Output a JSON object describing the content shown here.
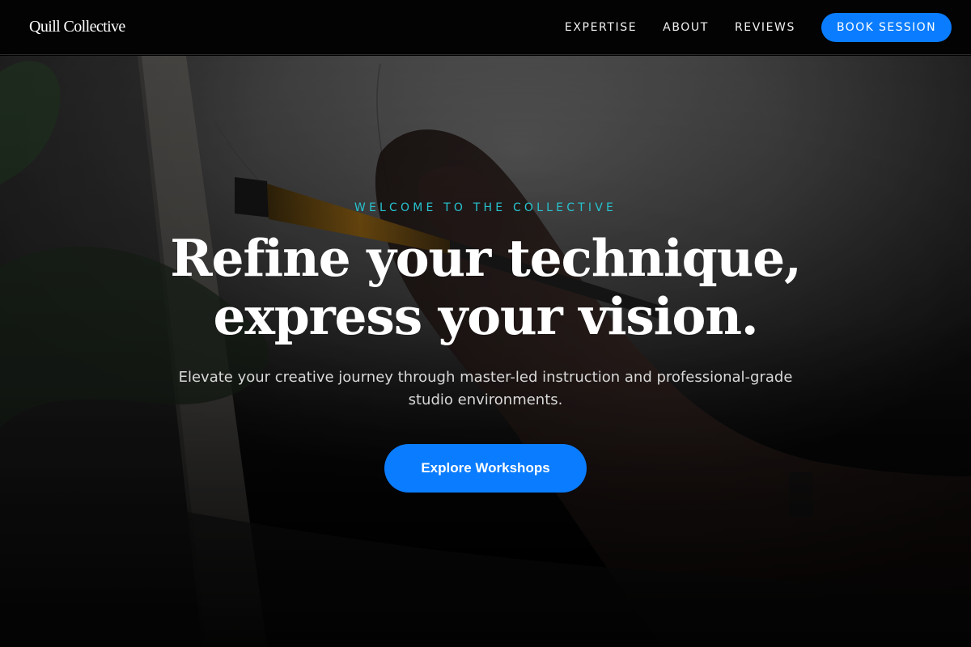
{
  "nav": {
    "brand": "Quill Collective",
    "links": [
      "EXPERTISE",
      "ABOUT",
      "REVIEWS"
    ],
    "cta": "BOOK SESSION"
  },
  "hero": {
    "eyebrow": "WELCOME TO THE COLLECTIVE",
    "headline_line1": "Refine your technique,",
    "headline_line2": "express your vision.",
    "subtext": "Elevate your creative journey through master-led instruction and professional-grade studio environments.",
    "cta": "Explore Workshops",
    "background_image": "artist-painting-photo"
  },
  "colors": {
    "accent": "#0a7cff",
    "eyebrow": "#27c3cf",
    "nav_bg": "#030303"
  }
}
